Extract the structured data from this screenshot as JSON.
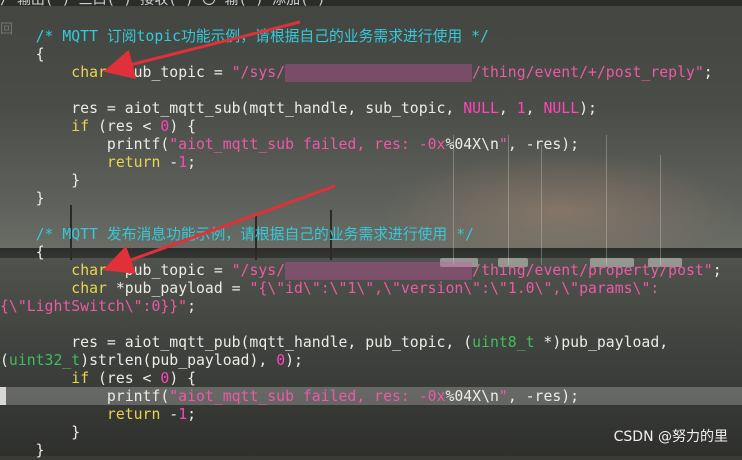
{
  "editor": {
    "top_line": "/ 输出( ) 三口( ) 接收( ) 〇 输( ) 添加( )",
    "side_glyph": "回",
    "lines": [
      {
        "parts": [
          [
            "c",
            "    /* MQTT 订阅topic功能示例，请根据自己的业务需求进行使用 */"
          ]
        ]
      },
      {
        "parts": [
          [
            "p",
            "    {"
          ]
        ]
      },
      {
        "parts": [
          [
            "p",
            "        "
          ],
          [
            "k",
            "char"
          ],
          [
            "p",
            " *sub_topic = "
          ],
          [
            "s",
            "\"/sys/"
          ],
          [
            "r",
            "xxxxxxxxxxxxxxxxxxxxx"
          ],
          [
            "s",
            "/thing/event/+/post_reply\""
          ],
          [
            "p",
            ";"
          ]
        ]
      },
      {
        "parts": [
          [
            "p",
            ""
          ]
        ]
      },
      {
        "parts": [
          [
            "p",
            "        res = aiot_mqtt_sub(mqtt_handle, sub_topic, "
          ],
          [
            "nul",
            "NULL"
          ],
          [
            "p",
            ", "
          ],
          [
            "n",
            "1"
          ],
          [
            "p",
            ", "
          ],
          [
            "nul",
            "NULL"
          ],
          [
            "p",
            ");"
          ]
        ]
      },
      {
        "parts": [
          [
            "p",
            "        "
          ],
          [
            "k",
            "if"
          ],
          [
            "p",
            " (res < "
          ],
          [
            "n",
            "0"
          ],
          [
            "p",
            ") {"
          ]
        ]
      },
      {
        "parts": [
          [
            "p",
            "            printf("
          ],
          [
            "s",
            "\"aiot_mqtt_sub failed, res: -0x"
          ],
          [
            "p",
            "%04X\\n"
          ],
          [
            "s",
            "\""
          ],
          [
            "p",
            ", -res);"
          ]
        ]
      },
      {
        "parts": [
          [
            "p",
            "            "
          ],
          [
            "k",
            "return"
          ],
          [
            "p",
            " -"
          ],
          [
            "n",
            "1"
          ],
          [
            "p",
            ";"
          ]
        ]
      },
      {
        "parts": [
          [
            "p",
            "        }"
          ]
        ]
      },
      {
        "parts": [
          [
            "p",
            "    }"
          ]
        ]
      },
      {
        "parts": [
          [
            "p",
            ""
          ]
        ]
      },
      {
        "parts": [
          [
            "c",
            "    /* MQTT 发布消息功能示例，请根据自己的业务需求进行使用 */"
          ]
        ]
      },
      {
        "parts": [
          [
            "p",
            "    {"
          ]
        ]
      },
      {
        "parts": [
          [
            "p",
            "        "
          ],
          [
            "k",
            "char"
          ],
          [
            "p",
            " *pub_topic = "
          ],
          [
            "s",
            "\"/sys/"
          ],
          [
            "r",
            "xxxxxxxxxxxxxxxxxxxxx"
          ],
          [
            "s",
            "/thing/event/property/post\""
          ],
          [
            "p",
            ";"
          ]
        ]
      },
      {
        "parts": [
          [
            "p",
            "        "
          ],
          [
            "k",
            "char"
          ],
          [
            "p",
            " *pub_payload = "
          ],
          [
            "s",
            "\"{\\\"id\\\":\\\"1\\\",\\\"version\\\":\\\"1.0\\\",\\\"params\\\":"
          ]
        ]
      },
      {
        "parts": [
          [
            "s",
            "{\\\"LightSwitch\\\":0}}\""
          ],
          [
            "p",
            ";"
          ]
        ]
      },
      {
        "parts": [
          [
            "p",
            ""
          ]
        ]
      },
      {
        "parts": [
          [
            "p",
            "        res = aiot_mqtt_pub(mqtt_handle, pub_topic, ("
          ],
          [
            "t",
            "uint8_t"
          ],
          [
            "p",
            " *)pub_payload,"
          ]
        ]
      },
      {
        "parts": [
          [
            "p",
            "("
          ],
          [
            "t",
            "uint32_t"
          ],
          [
            "p",
            ")strlen(pub_payload), "
          ],
          [
            "n",
            "0"
          ],
          [
            "p",
            ");"
          ]
        ]
      },
      {
        "parts": [
          [
            "p",
            "        "
          ],
          [
            "k",
            "if"
          ],
          [
            "p",
            " (res < "
          ],
          [
            "n",
            "0"
          ],
          [
            "p",
            ") {"
          ]
        ]
      },
      {
        "parts": [
          [
            "p",
            "            printf("
          ],
          [
            "s",
            "\"aiot_mqtt_sub failed, res: -0x"
          ],
          [
            "p",
            "%04X\\n"
          ],
          [
            "s",
            "\""
          ],
          [
            "p",
            ", -res);"
          ]
        ]
      },
      {
        "parts": [
          [
            "p",
            "            "
          ],
          [
            "k",
            "return"
          ],
          [
            "p",
            " -"
          ],
          [
            "n",
            "1"
          ],
          [
            "p",
            ";"
          ]
        ]
      },
      {
        "parts": [
          [
            "p",
            "        }"
          ]
        ]
      },
      {
        "parts": [
          [
            "p",
            "    }"
          ]
        ]
      }
    ]
  },
  "watermark": "CSDN @努力的里"
}
